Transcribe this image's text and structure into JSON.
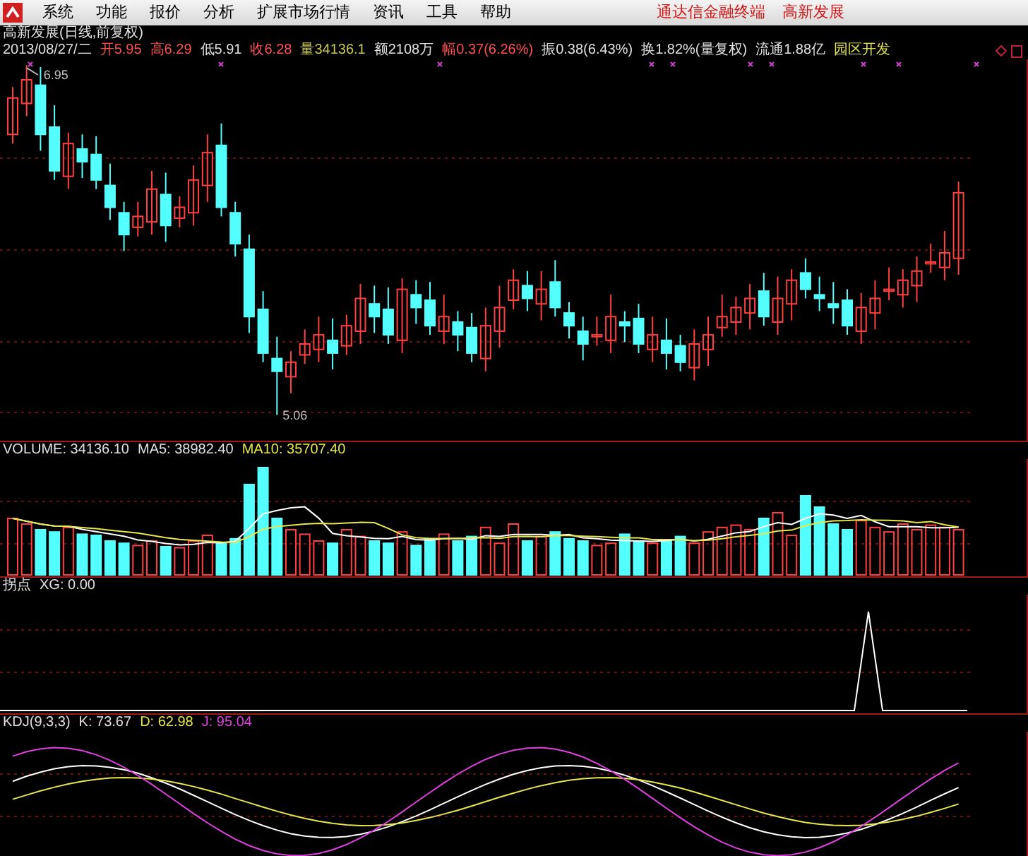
{
  "menu": {
    "items": [
      "系统",
      "功能",
      "报价",
      "分析",
      "扩展市场行情",
      "资讯",
      "工具",
      "帮助"
    ],
    "right_texts": [
      "通达信金融终端",
      "高新发展"
    ]
  },
  "title": "高新发展(日线,前复权)",
  "quote_fields": [
    {
      "text": "2013/08/27/二",
      "color": "#e0e0e0"
    },
    {
      "text": "开5.95",
      "color": "#ff5050"
    },
    {
      "text": "高6.29",
      "color": "#ff5050"
    },
    {
      "text": "低5.91",
      "color": "#e0e0e0"
    },
    {
      "text": "收6.28",
      "color": "#ff5050"
    },
    {
      "text": "量34136.1",
      "color": "#c8c850"
    },
    {
      "text": "额2108万",
      "color": "#e0e0e0"
    },
    {
      "text": "幅0.37(6.26%)",
      "color": "#ff5050"
    },
    {
      "text": "振0.38(6.43%)",
      "color": "#e0e0e0"
    },
    {
      "text": "换1.82%(量复权)",
      "color": "#e0e0e0"
    },
    {
      "text": "流通1.88亿",
      "color": "#e0e0e0"
    },
    {
      "text": "园区开发",
      "color": "#e6e64c"
    }
  ],
  "price_chart": {
    "high_label": "6.95",
    "low_label": "5.06"
  },
  "volume_panel": {
    "fields": [
      {
        "text": "VOLUME: 34136.10",
        "color": "#e0e0e0"
      },
      {
        "text": "MA5: 38982.40",
        "color": "#e0e0e0"
      },
      {
        "text": "MA10: 35707.40",
        "color": "#e6e64c"
      }
    ]
  },
  "signal_panel": {
    "fields": [
      {
        "text": "拐点",
        "color": "#e0e0e0"
      },
      {
        "text": "XG: 0.00",
        "color": "#e0e0e0"
      }
    ]
  },
  "kdj_panel": {
    "fields": [
      {
        "text": "KDJ(9,3,3)",
        "color": "#e0e0e0"
      },
      {
        "text": "K: 73.67",
        "color": "#e0e0e0"
      },
      {
        "text": "D: 62.98",
        "color": "#e6e64c"
      },
      {
        "text": "J: 95.04",
        "color": "#e040e0"
      }
    ]
  }
}
